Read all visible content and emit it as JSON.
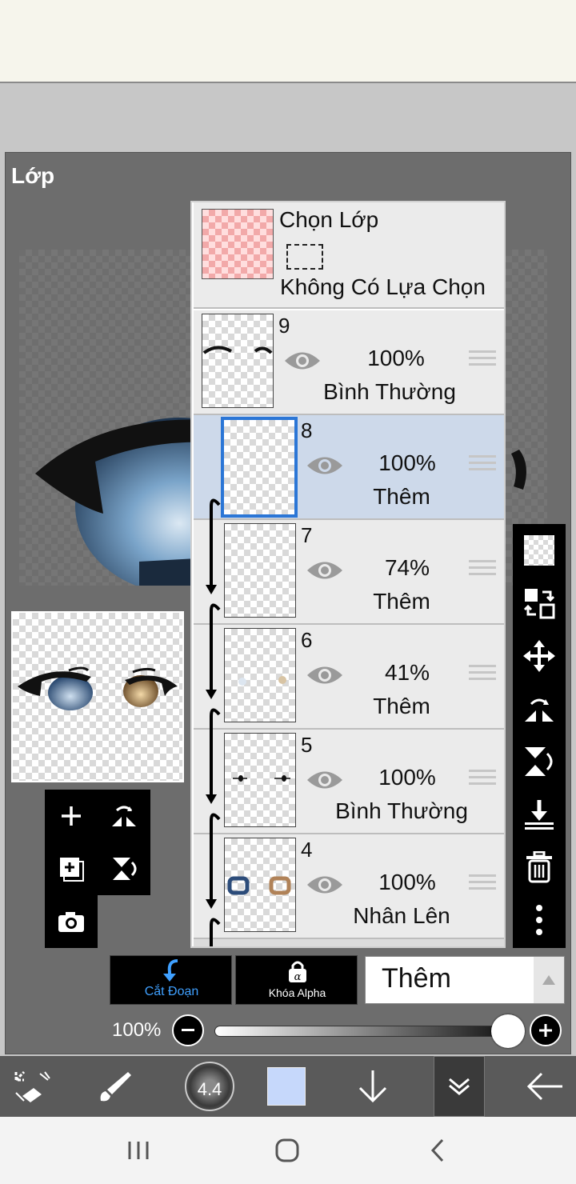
{
  "dialog": {
    "title": "Lớp"
  },
  "selection_row": {
    "title": "Chọn Lớp",
    "status": "Không Có Lựa Chọn"
  },
  "layers": [
    {
      "number": "9",
      "opacity": "100%",
      "blend": "Bình Thường",
      "selected": false,
      "clipped": false
    },
    {
      "number": "8",
      "opacity": "100%",
      "blend": "Thêm",
      "selected": true,
      "clipped": true
    },
    {
      "number": "7",
      "opacity": "74%",
      "blend": "Thêm",
      "selected": false,
      "clipped": true
    },
    {
      "number": "6",
      "opacity": "41%",
      "blend": "Thêm",
      "selected": false,
      "clipped": true
    },
    {
      "number": "5",
      "opacity": "100%",
      "blend": "Bình Thường",
      "selected": false,
      "clipped": true
    },
    {
      "number": "4",
      "opacity": "100%",
      "blend": "Nhân Lên",
      "selected": false,
      "clipped": true
    }
  ],
  "bottom": {
    "clip_label": "Cắt Đoạn",
    "alpha_label": "Khóa Alpha",
    "blend_mode": "Thêm",
    "opacity_value": "100%",
    "opacity_fraction": 1.0
  },
  "toolbar": {
    "brush_size": "4.4"
  },
  "colors": {
    "accent": "#2b76d6",
    "selected_row": "#cdd9ea",
    "current_color": "#c6d8fb"
  },
  "icons": {
    "right_toolbar": [
      "transparency-icon",
      "swap-layer-icon",
      "move-icon",
      "flip-horizontal-icon",
      "flip-vertical-icon",
      "merge-down-icon",
      "trash-icon",
      "more-icon"
    ],
    "mini_tools": [
      "add-layer-icon",
      "flip-icon",
      "add-copy-icon",
      "flip-vertical-icon",
      "camera-icon"
    ]
  }
}
